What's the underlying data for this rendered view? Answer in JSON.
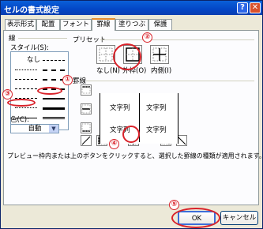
{
  "window": {
    "title": "セルの書式設定",
    "help": "?",
    "close": "✕"
  },
  "tabs": [
    "表示形式",
    "配置",
    "フォント",
    "罫線",
    "塗りつぶし",
    "保護"
  ],
  "line_group": {
    "title": "線",
    "style_label": "スタイル(S):",
    "none_label": "なし",
    "color_label": "色(C):",
    "color_value": "自動"
  },
  "preset_group": {
    "title": "プリセット",
    "none": "なし(N)",
    "outline": "外枠(O)",
    "inside": "内側(I)"
  },
  "border_group": {
    "title": "罫線",
    "cell_text": "文字列"
  },
  "hint": "プレビュー枠内または上のボタンをクリックすると、選択した罫線の種類が適用されます。",
  "buttons": {
    "ok": "OK",
    "cancel": "キャンセル"
  },
  "markers": [
    "①",
    "②",
    "③",
    "④",
    "⑤"
  ],
  "colors": {
    "annotation": "#d9222a",
    "title_bar": "#0346c6",
    "active_tab": "#e68b2c"
  }
}
